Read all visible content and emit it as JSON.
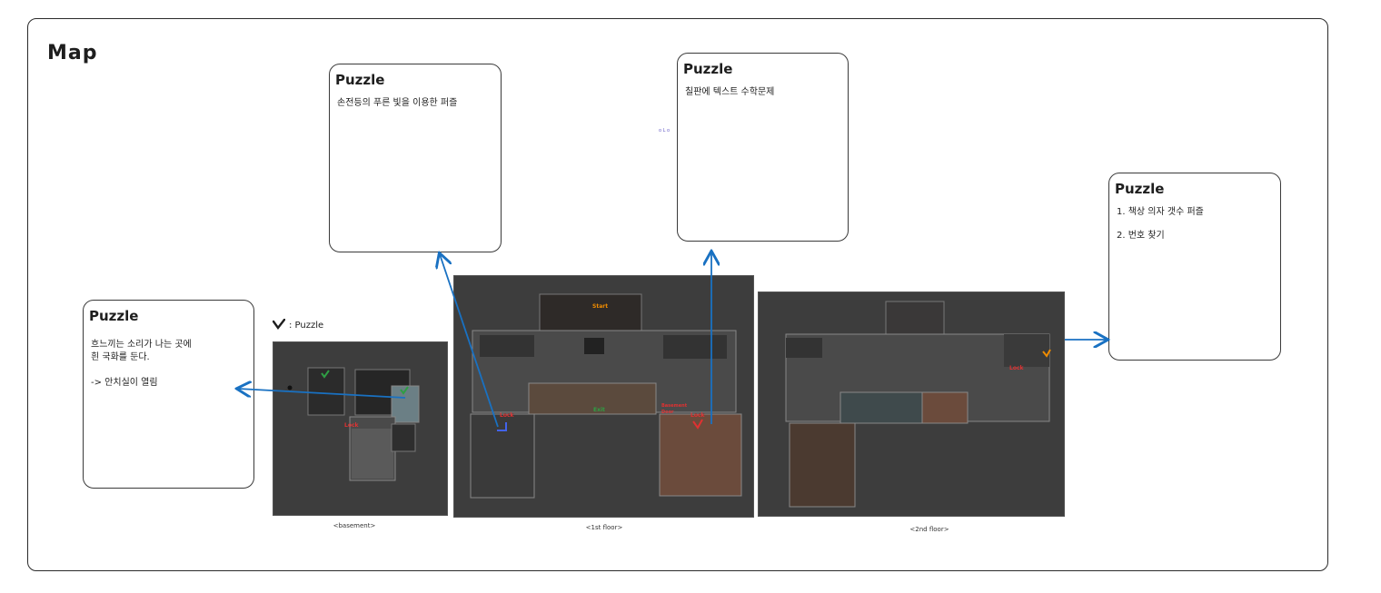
{
  "title": "Map",
  "legend": {
    "icon": "check-mark-icon",
    "label": ": Puzzle"
  },
  "stray_text": "o L o",
  "cards": [
    {
      "title": "Puzzle",
      "lines": [
        "흐느끼는 소리가 나는 곳에",
        "흰 국화를 둔다.",
        "",
        "-> 안치실이 열림"
      ]
    },
    {
      "title": "Puzzle",
      "lines": [
        "손전등의 푸른 빛을 이용한 퍼즐"
      ]
    },
    {
      "title": "Puzzle",
      "lines": [
        "칠판에 텍스트 수학문제"
      ]
    },
    {
      "title": "Puzzle",
      "lines": [
        "1. 책상 의자 갯수 퍼즐",
        "",
        "2. 번호 찾기"
      ]
    }
  ],
  "floors": [
    {
      "caption": "<basement>",
      "labels": [
        "Lock"
      ]
    },
    {
      "caption": "<1st floor>",
      "labels": [
        "Start",
        "Lock",
        "Exit",
        "Basement Door",
        "Lock"
      ]
    },
    {
      "caption": "<2nd floor>",
      "labels": [
        "Lock"
      ]
    }
  ],
  "colors": {
    "arrow": "#1971c2",
    "floor_bg": "#3d3d3d",
    "lock": "#e03131",
    "start": "#f08c00",
    "exit": "#2f9e44",
    "check": "#2f9e44"
  }
}
